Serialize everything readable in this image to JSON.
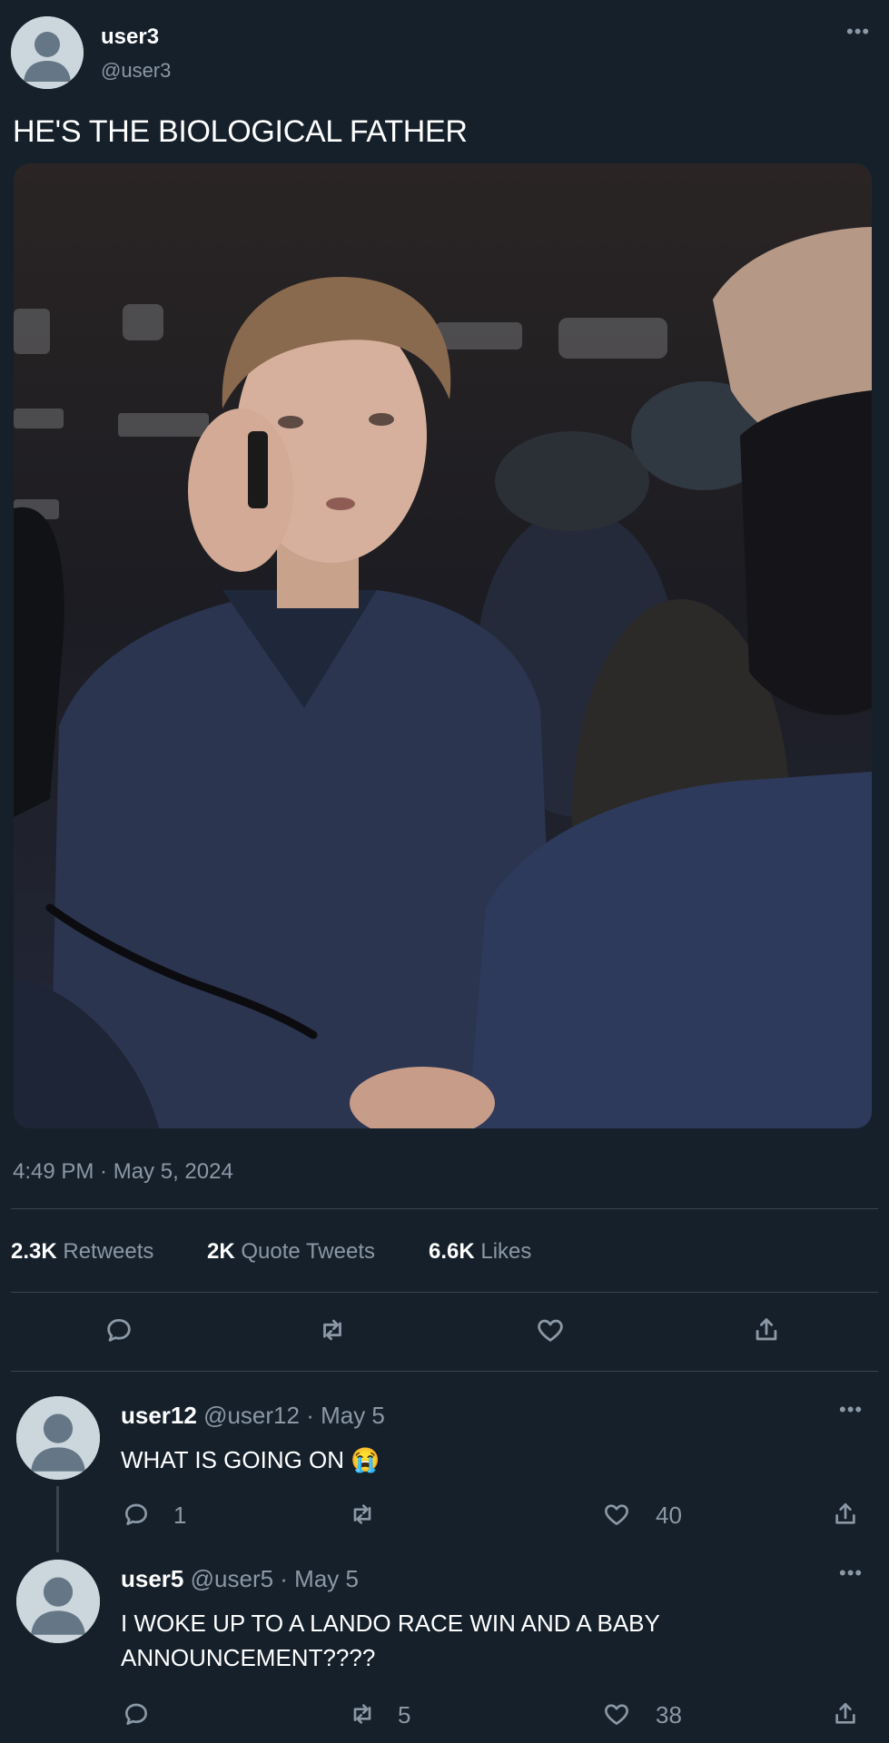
{
  "tweet": {
    "display_name": "user3",
    "handle": "@user3",
    "text": "HE'S THE BIOLOGICAL FATHER",
    "timestamp": "4:49 PM · May 5, 2024",
    "media_icon": "photo-of-person-on-phone",
    "stats": {
      "retweets_count": "2.3K",
      "retweets_label": "Retweets",
      "quotes_count": "2K",
      "quotes_label": "Quote Tweets",
      "likes_count": "6.6K",
      "likes_label": "Likes"
    }
  },
  "replies": [
    {
      "display_name": "user12",
      "meta": "@user12 · May 5",
      "text": "WHAT IS GOING ON 😭",
      "reply_count": "1",
      "retweet_count": "",
      "like_count": "40"
    },
    {
      "display_name": "user5",
      "meta": "@user5 · May 5",
      "text_line1": "I WOKE UP TO A LANDO RACE WIN AND A BABY",
      "text_line2": "ANNOUNCEMENT????",
      "reply_count": "",
      "retweet_count": "5",
      "like_count": "38"
    }
  ],
  "colors": {
    "background": "#15202b",
    "muted": "#8b98a5",
    "divider": "#38444d"
  }
}
